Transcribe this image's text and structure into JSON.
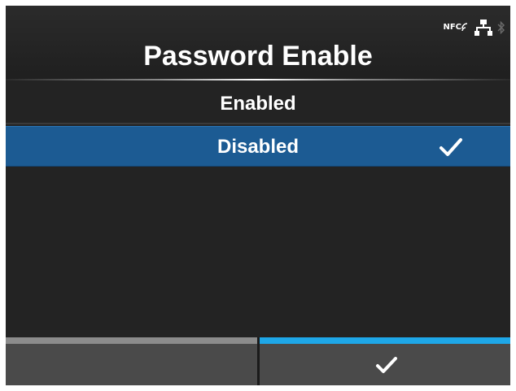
{
  "header": {
    "title": "Password Enable",
    "status": {
      "nfc_label": "NFC",
      "network_icon": "network-icon",
      "bluetooth_icon": "bluetooth-icon"
    }
  },
  "list": {
    "items": [
      {
        "label": "Enabled",
        "selected": false
      },
      {
        "label": "Disabled",
        "selected": true
      }
    ],
    "selected_icon": "check-icon"
  },
  "footer": {
    "left_button": {
      "label": ""
    },
    "right_button": {
      "icon": "check-icon"
    }
  },
  "colors": {
    "background": "#232323",
    "selected_row": "#1c5b93",
    "accent": "#1ea7e8",
    "inactive_bar": "#8c8c8c",
    "text": "#ffffff"
  }
}
